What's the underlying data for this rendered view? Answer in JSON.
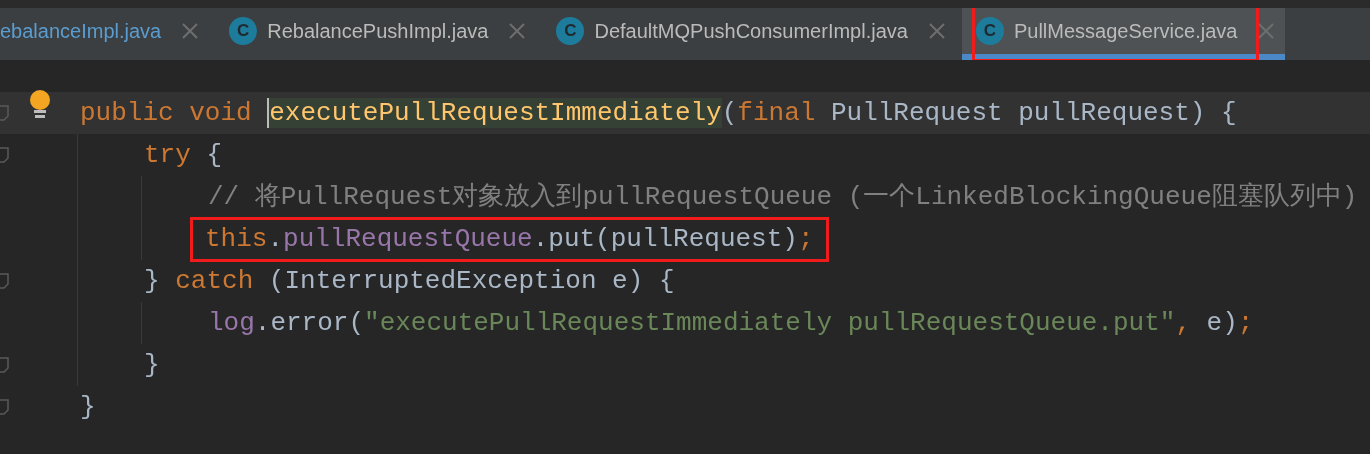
{
  "tabs": [
    {
      "label": "ebalanceImpl.java",
      "modified": true,
      "selected": false,
      "annotated": false
    },
    {
      "label": "RebalancePushImpl.java",
      "badge": "C",
      "modified": false,
      "selected": false,
      "annotated": false
    },
    {
      "label": "DefaultMQPushConsumerImpl.java",
      "badge": "C",
      "modified": false,
      "selected": false,
      "annotated": false
    },
    {
      "label": "PullMessageService.java",
      "badge": "C",
      "modified": false,
      "selected": true,
      "annotated": true
    }
  ],
  "code": {
    "lines": [
      {
        "foldable": true,
        "bulb": true,
        "annotated": false,
        "tokens": [
          {
            "kind": "keyword",
            "text": "public void "
          },
          {
            "kind": "method",
            "text": "executePullRequestImmediately",
            "highlighted": true
          },
          {
            "kind": "plain",
            "text": "("
          },
          {
            "kind": "keyword",
            "text": "final "
          },
          {
            "kind": "plain",
            "text": "PullRequest pullRequest) {"
          }
        ],
        "children": [
          {
            "foldable": true,
            "bulb": false,
            "annotated": false,
            "tokens": [
              {
                "kind": "keyword",
                "text": "try"
              },
              {
                "kind": "plain",
                "text": " {"
              }
            ],
            "children": [
              {
                "foldable": false,
                "bulb": false,
                "annotated": false,
                "tokens": [
                  {
                    "kind": "comment",
                    "text": "// 将PullRequest对象放入到pullRequestQueue (一个LinkedBlockingQueue阻塞队列中)"
                  }
                ]
              },
              {
                "foldable": false,
                "bulb": false,
                "annotated": true,
                "tokens": [
                  {
                    "kind": "keyword",
                    "text": "this"
                  },
                  {
                    "kind": "plain",
                    "text": "."
                  },
                  {
                    "kind": "field",
                    "text": "pullRequestQueue"
                  },
                  {
                    "kind": "plain",
                    "text": ".put(pullRequest)"
                  },
                  {
                    "kind": "keyword",
                    "text": ";"
                  }
                ]
              }
            ]
          },
          {
            "foldable": true,
            "bulb": false,
            "annotated": false,
            "tokens": [
              {
                "kind": "plain",
                "text": "} "
              },
              {
                "kind": "keyword",
                "text": "catch"
              },
              {
                "kind": "plain",
                "text": " (InterruptedException e) {"
              }
            ],
            "children": [
              {
                "foldable": false,
                "bulb": false,
                "annotated": false,
                "tokens": [
                  {
                    "kind": "field",
                    "text": "log"
                  },
                  {
                    "kind": "plain",
                    "text": ".error("
                  },
                  {
                    "kind": "string",
                    "text": "\"executePullRequestImmediately pullRequestQueue.put\""
                  },
                  {
                    "kind": "keyword",
                    "text": ","
                  },
                  {
                    "kind": "plain",
                    "text": " e)"
                  },
                  {
                    "kind": "keyword",
                    "text": ";"
                  }
                ]
              }
            ]
          },
          {
            "foldable": true,
            "bulb": false,
            "annotated": false,
            "tokens": [
              {
                "kind": "plain",
                "text": "}"
              }
            ]
          }
        ]
      },
      {
        "foldable": true,
        "bulb": false,
        "annotated": false,
        "tokens": [
          {
            "kind": "plain",
            "text": "}"
          }
        ]
      }
    ]
  }
}
